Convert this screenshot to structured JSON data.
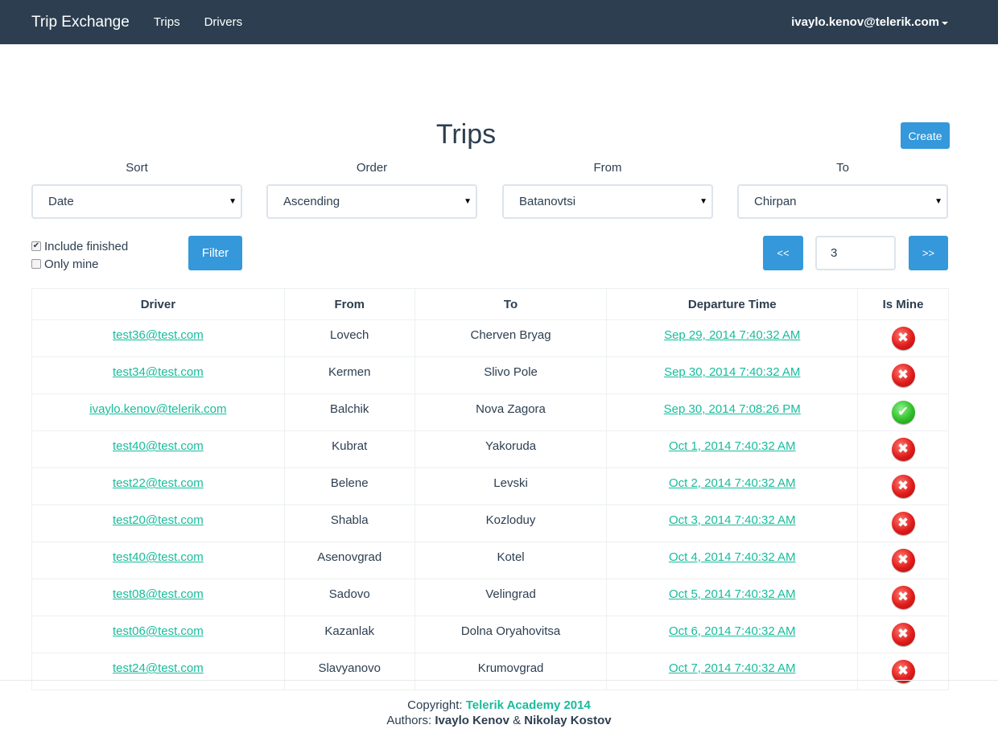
{
  "navbar": {
    "brand": "Trip Exchange",
    "links": [
      "Trips",
      "Drivers"
    ],
    "user": "ivaylo.kenov@telerik.com"
  },
  "page": {
    "title": "Trips",
    "create_label": "Create"
  },
  "filters": [
    {
      "label": "Sort",
      "value": "Date"
    },
    {
      "label": "Order",
      "value": "Ascending"
    },
    {
      "label": "From",
      "value": "Batanovtsi"
    },
    {
      "label": "To",
      "value": "Chirpan"
    }
  ],
  "options": {
    "include_finished": {
      "label": "Include finished",
      "checked": true
    },
    "only_mine": {
      "label": "Only mine",
      "checked": false
    },
    "filter_label": "Filter"
  },
  "pager": {
    "prev_label": "<<",
    "next_label": ">>",
    "page": "3"
  },
  "table": {
    "headers": [
      "Driver",
      "From",
      "To",
      "Departure Time",
      "Is Mine"
    ],
    "rows": [
      {
        "driver": "test36@test.com",
        "from": "Lovech",
        "to": "Cherven Bryag",
        "departure": "Sep 29, 2014 7:40:32 AM",
        "is_mine": false
      },
      {
        "driver": "test34@test.com",
        "from": "Kermen",
        "to": "Slivo Pole",
        "departure": "Sep 30, 2014 7:40:32 AM",
        "is_mine": false
      },
      {
        "driver": "ivaylo.kenov@telerik.com",
        "from": "Balchik",
        "to": "Nova Zagora",
        "departure": "Sep 30, 2014 7:08:26 PM",
        "is_mine": true
      },
      {
        "driver": "test40@test.com",
        "from": "Kubrat",
        "to": "Yakoruda",
        "departure": "Oct 1, 2014 7:40:32 AM",
        "is_mine": false
      },
      {
        "driver": "test22@test.com",
        "from": "Belene",
        "to": "Levski",
        "departure": "Oct 2, 2014 7:40:32 AM",
        "is_mine": false
      },
      {
        "driver": "test20@test.com",
        "from": "Shabla",
        "to": "Kozloduy",
        "departure": "Oct 3, 2014 7:40:32 AM",
        "is_mine": false
      },
      {
        "driver": "test40@test.com",
        "from": "Asenovgrad",
        "to": "Kotel",
        "departure": "Oct 4, 2014 7:40:32 AM",
        "is_mine": false
      },
      {
        "driver": "test08@test.com",
        "from": "Sadovo",
        "to": "Velingrad",
        "departure": "Oct 5, 2014 7:40:32 AM",
        "is_mine": false
      },
      {
        "driver": "test06@test.com",
        "from": "Kazanlak",
        "to": "Dolna Oryahovitsa",
        "departure": "Oct 6, 2014 7:40:32 AM",
        "is_mine": false
      },
      {
        "driver": "test24@test.com",
        "from": "Slavyanovo",
        "to": "Krumovgrad",
        "departure": "Oct 7, 2014 7:40:32 AM",
        "is_mine": false
      }
    ]
  },
  "footer": {
    "copyright_label": "Copyright:",
    "copyright_link": "Telerik Academy 2014",
    "authors_label": "Authors:",
    "author1": "Ivaylo Kenov",
    "amp": "&",
    "author2": "Nikolay Kostov"
  },
  "icons": {
    "not_mine": "red-x-icon",
    "mine": "green-check-icon"
  },
  "colors": {
    "navbar": "#2c3e50",
    "primary": "#3498db",
    "link": "#18bc9c",
    "no": "#e01b1b",
    "yes": "#2fbf29"
  }
}
